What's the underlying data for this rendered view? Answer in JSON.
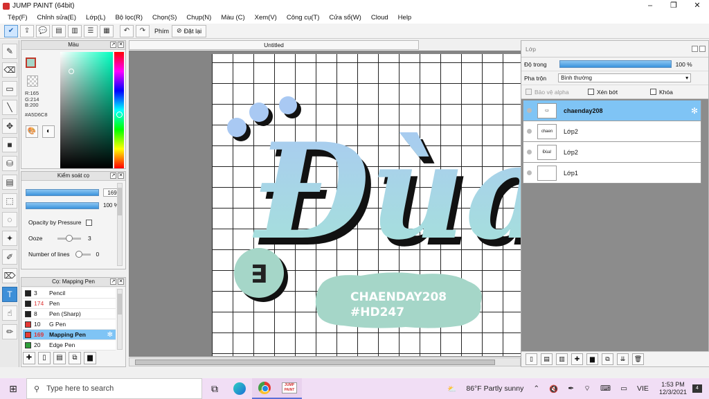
{
  "window": {
    "title": "JUMP PAINT (64bit)",
    "controls": [
      "–",
      "❐",
      "✕"
    ]
  },
  "menu": [
    "Tệp(F)",
    "Chỉnh sửa(E)",
    "Lớp(L)",
    "Bộ lọc(R)",
    "Chọn(S)",
    "Chụp(N)",
    "Màu (C)",
    "Xem(V)",
    "Công cụ(T)",
    "Cửa sổ(W)",
    "Cloud",
    "Help"
  ],
  "toolbar": {
    "key_label": "Phím",
    "reset_label": "Đặt lại"
  },
  "color_panel": {
    "title": "Màu",
    "r": "R:165",
    "g": "G:214",
    "b": "B:200",
    "hex": "#A5D6C8",
    "current_color": "#A5D6C8"
  },
  "brush_panel": {
    "title": "Kiểm soát cọ",
    "size_value": "169",
    "opacity_value": "100 %",
    "opacity_by_pressure": "Opacity by Pressure",
    "ooze_label": "Ooze",
    "ooze_value": "3",
    "lines_label": "Number of lines",
    "lines_value": "0"
  },
  "pen_panel": {
    "title": "Cọ: Mapping Pen",
    "pens": [
      {
        "num": "3",
        "name": "Pencil",
        "color": "#222222",
        "red": false,
        "selected": false
      },
      {
        "num": "174",
        "name": "Pen",
        "color": "#222222",
        "red": true,
        "selected": false
      },
      {
        "num": "8",
        "name": "Pen (Sharp)",
        "color": "#222222",
        "red": false,
        "selected": false
      },
      {
        "num": "10",
        "name": "G Pen",
        "color": "#e53935",
        "red": false,
        "selected": false
      },
      {
        "num": "169",
        "name": "Mapping Pen",
        "color": "#e53935",
        "red": true,
        "selected": true
      },
      {
        "num": "20",
        "name": "Edge Pen",
        "color": "#2e9e3a",
        "red": false,
        "selected": false
      }
    ]
  },
  "document": {
    "tab_title": "Untitled"
  },
  "artwork": {
    "title_text": "Đùa",
    "badge_text": "CHAENDAY208",
    "hashtag_text": "#HD247",
    "colors": {
      "gradient_top": "#a9c9f3",
      "gradient_bottom": "#a5e3d8",
      "shadow": "#111111",
      "blob": "#a5d6c8",
      "circle": "#a5d6c8"
    }
  },
  "layer_panel": {
    "title": "Lớp",
    "opacity_label": "Độ trong",
    "opacity_value": "100 %",
    "blend_label": "Pha trộn",
    "blend_value": "Bình thường",
    "protect_alpha": "Bảo vệ alpha",
    "clipping": "Xén bớt",
    "lock": "Khóa",
    "layers": [
      {
        "name": "chaenday208",
        "thumb": "▭",
        "selected": true
      },
      {
        "name": "Lớp2",
        "thumb": "chaen",
        "selected": false
      },
      {
        "name": "Lớp2",
        "thumb": "Đùa!",
        "selected": false
      },
      {
        "name": "Lớp1",
        "thumb": "",
        "selected": false
      }
    ]
  },
  "taskbar": {
    "search_placeholder": "Type here to search",
    "weather": "86°F  Partly sunny",
    "language": "VIE",
    "time": "1:53 PM",
    "date": "12/3/2021",
    "notifications": "4"
  }
}
